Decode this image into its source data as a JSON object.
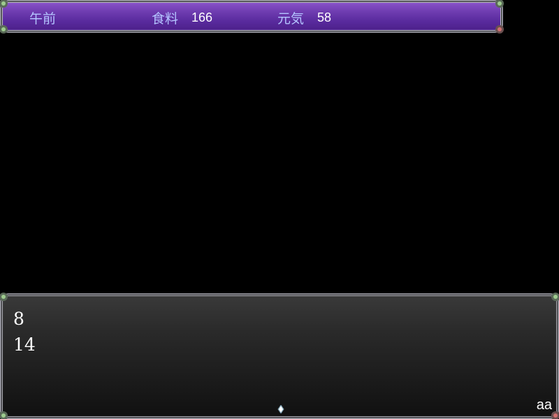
{
  "status_bar": {
    "time_label": "午前",
    "food_label": "食料",
    "food_value": "166",
    "energy_label": "元気",
    "energy_value": "58"
  },
  "message_window": {
    "lines": [
      "8",
      "14"
    ],
    "speaker_tag": "aa"
  },
  "colors": {
    "status_bar_top": "#8c55cc",
    "status_bar_bottom": "#4a1f88",
    "status_label": "#b4c4ff",
    "message_window_top": "#3a3a3a",
    "message_window_bottom": "#101010"
  },
  "icons": {
    "continue_cursor": "continue-cursor-icon",
    "corner": "corner-gem-icon"
  }
}
